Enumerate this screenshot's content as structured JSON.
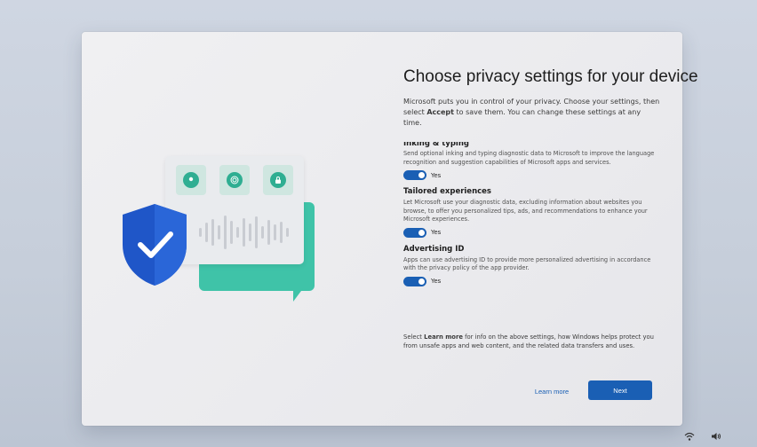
{
  "page": {
    "title": "Choose privacy settings for your device",
    "intro_pre": "Microsoft puts you in control of your privacy. Choose your settings, then select ",
    "intro_bold": "Accept",
    "intro_post": " to save them. You can change these settings at any time."
  },
  "sections": [
    {
      "heading": "Inking & typing",
      "description": "Send optional inking and typing diagnostic data to Microsoft to improve the language recognition and suggestion capabilities of Microsoft apps and services.",
      "toggle_label": "Yes"
    },
    {
      "heading": "Tailored experiences",
      "description": "Let Microsoft use your diagnostic data, excluding information about websites you browse, to offer you personalized tips, ads, and recommendations to enhance your Microsoft experiences.",
      "toggle_label": "Yes"
    },
    {
      "heading": "Advertising ID",
      "description": "Apps can use advertising ID to provide more personalized advertising in accordance with the privacy policy of the app provider.",
      "toggle_label": "Yes"
    }
  ],
  "footer": {
    "pre": "Select ",
    "bold": "Learn more",
    "post": " for info on the above settings, how Windows helps protect you from unsafe apps and web content, and the related data transfers and uses."
  },
  "buttons": {
    "learn_more": "Learn more",
    "next": "Next"
  },
  "tray": {
    "network_icon": "network-icon",
    "volume_icon": "volume-icon"
  },
  "colors": {
    "accent": "#1a5fb4",
    "illustration_green": "#3fc3a8",
    "shield_blue": "#1f56c8"
  }
}
